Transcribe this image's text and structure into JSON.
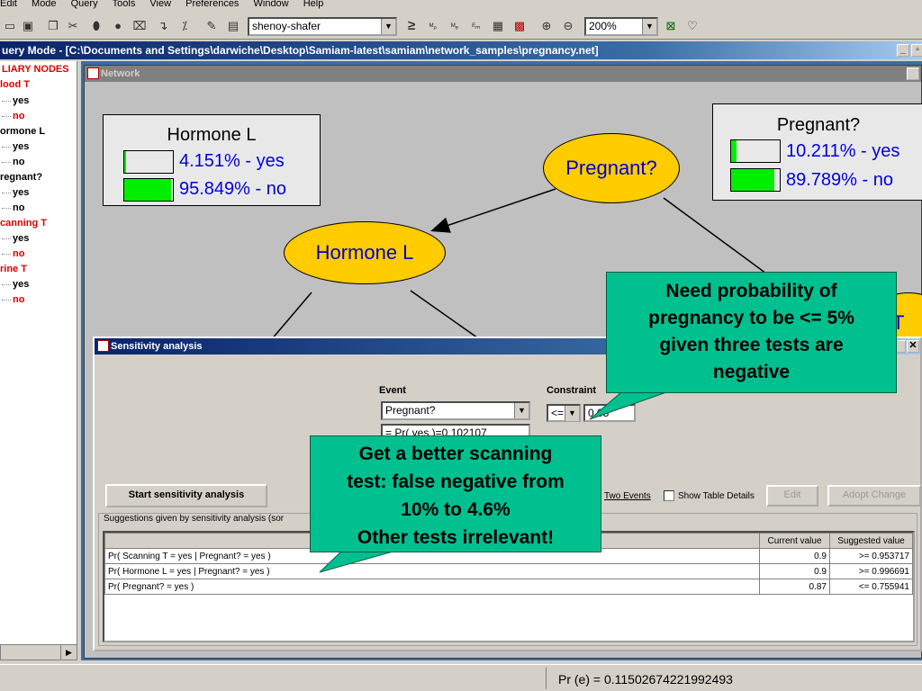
{
  "menu": [
    "Edit",
    "Mode",
    "Query",
    "Tools",
    "View",
    "Preferences",
    "Window",
    "Help"
  ],
  "toolbar": {
    "algorithm": "shenoy-shafer",
    "zoom": "200%",
    "ge_symbol": "≥"
  },
  "window_title": "uery Mode - [C:\\Documents and Settings\\darwiche\\Desktop\\Samiam-latest\\samiam\\network_samples\\pregnancy.net]",
  "tree": {
    "header": "LIARY NODES",
    "nodes": [
      {
        "name": "lood T",
        "red": true,
        "states": [
          {
            "label": "yes",
            "red": false
          },
          {
            "label": "no",
            "red": true
          }
        ]
      },
      {
        "name": "ormone L",
        "red": false,
        "states": [
          {
            "label": "yes",
            "red": false
          },
          {
            "label": "no",
            "red": false
          }
        ]
      },
      {
        "name": "regnant?",
        "red": false,
        "states": [
          {
            "label": "yes",
            "red": false
          },
          {
            "label": "no",
            "red": false
          }
        ]
      },
      {
        "name": "canning T",
        "red": true,
        "states": [
          {
            "label": "yes",
            "red": false
          },
          {
            "label": "no",
            "red": true
          }
        ]
      },
      {
        "name": "rine T",
        "red": true,
        "states": [
          {
            "label": "yes",
            "red": false
          },
          {
            "label": "no",
            "red": true
          }
        ]
      }
    ]
  },
  "network": {
    "title": "Network",
    "hormone_monitor": {
      "title": "Hormone L",
      "yes": "4.151% - yes",
      "no": "95.849% - no",
      "yes_frac": 0.04151,
      "no_frac": 0.95849
    },
    "pregnant_monitor": {
      "title": "Pregnant?",
      "yes": "10.211% - yes",
      "no": "89.789% - no",
      "yes_frac": 0.10211,
      "no_frac": 0.89789
    },
    "node_pregnant": "Pregnant?",
    "node_hormone": "Hormone L",
    "node_partial": "T"
  },
  "sensitivity": {
    "title": "Sensitivity analysis",
    "event_label": "Event",
    "event_value": "Pregnant?",
    "event_value2": "= Pr( yes )=0.102107",
    "constraint_label": "Constraint",
    "constraint_op": "<=",
    "constraint_value": "0.05",
    "start_button": "Start sensitivity analysis",
    "two_events": "Two Events",
    "show_table_details": "Show Table Details",
    "edit_button": "Edit",
    "adopt_button": "Adopt Change",
    "suggestions_label": "Suggestions given by sensitivity analysis (sor",
    "columns": {
      "current": "Current value",
      "suggested": "Suggested value"
    },
    "rows": [
      {
        "param": "Pr( Scanning T = yes | Pregnant? = yes )",
        "current": "0.9",
        "suggested": ">= 0.953717"
      },
      {
        "param": "Pr( Hormone L = yes | Pregnant? = yes )",
        "current": "0.9",
        "suggested": ">= 0.996691"
      },
      {
        "param": "Pr( Pregnant? = yes )",
        "current": "0.87",
        "suggested": "<= 0.755941"
      }
    ]
  },
  "callouts": {
    "top": [
      "Need probability of",
      "pregnancy to be <= 5%",
      "given three tests are",
      "negative"
    ],
    "bottom": [
      "Get a better scanning",
      "test: false negative from",
      "10% to 4.6%",
      "Other tests irrelevant!"
    ]
  },
  "status": "Pr (e) = 0.11502674221992493"
}
